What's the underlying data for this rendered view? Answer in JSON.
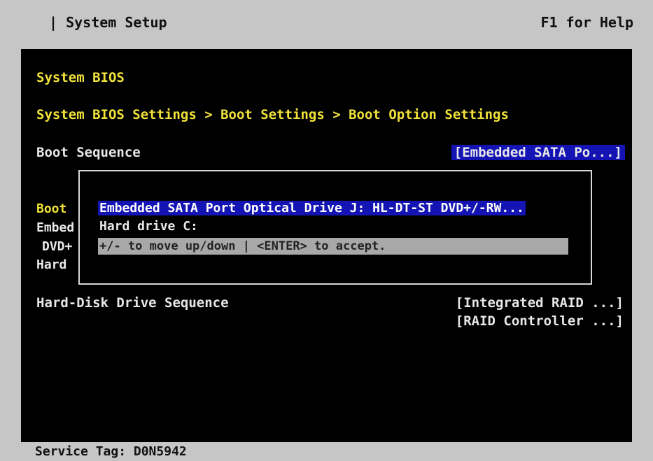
{
  "header": {
    "title": "| System Setup",
    "help": "F1 for Help"
  },
  "main": {
    "section_title": "System BIOS",
    "breadcrumb": "System BIOS Settings > Boot Settings > Boot Option Settings",
    "boot_sequence": {
      "label": "Boot Sequence",
      "value": "[Embedded SATA Po...]"
    },
    "behind_rows": [
      "Boot",
      "Embed",
      "DVD+",
      "Hard"
    ],
    "hard_disk_sequence": {
      "label": "Hard-Disk Drive Sequence",
      "values": [
        "[Integrated RAID ...]",
        "[RAID Controller ...]"
      ]
    }
  },
  "popup": {
    "items": [
      "Embedded SATA Port Optical Drive J: HL-DT-ST DVD+/-RW...",
      "Hard drive C:"
    ],
    "selected_index": 0,
    "hint": "+/- to move up/down | <ENTER> to accept."
  },
  "footer": {
    "service_tag": "Service Tag: D0N5942"
  },
  "colors": {
    "screen_bg": "#000000",
    "frame_bg": "#c6c6c6",
    "title_text": "#f0e23a",
    "highlight_bg": "#1414b4",
    "hint_bg": "#a8a8a8"
  }
}
